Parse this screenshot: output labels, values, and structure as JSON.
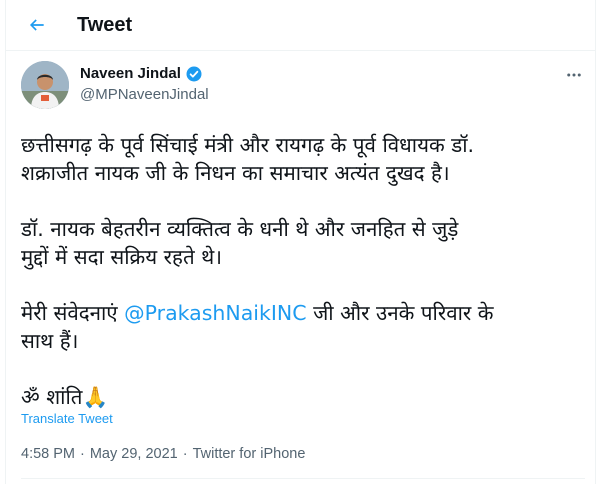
{
  "header": {
    "title": "Tweet",
    "back_icon": "arrow-left-icon"
  },
  "author": {
    "name": "Naveen Jindal",
    "handle": "@MPNaveenJindal",
    "verified": true,
    "verified_color": "#1d9bf0"
  },
  "tweet": {
    "para1_line1": "छत्तीसगढ़ के पूर्व सिंचाई मंत्री और रायगढ़ के पूर्व विधायक डॉ.",
    "para1_line2": "शक्राजीत नायक जी के निधन का समाचार अत्यंत दुखद है।",
    "para2_line1": "डॉ. नायक बेहतरीन व्यक्तित्व के धनी थे और जनहित से जुड़े",
    "para2_line2": "मुद्दों में सदा सक्रिय रहते थे।",
    "para3_prefix": "मेरी संवेदनाएं ",
    "para3_mention": "@PrakashNaikINC",
    "para3_suffix": " जी और उनके परिवार के",
    "para3_line2": "साथ हैं।",
    "para4_text": "ॐ शांति",
    "para4_emoji": "🙏"
  },
  "translate_label": "Translate Tweet",
  "meta": {
    "time": "4:58 PM",
    "sep1": "·",
    "date": "May 29, 2021",
    "sep2": "·",
    "source": "Twitter for iPhone"
  },
  "colors": {
    "accent": "#1d9bf0",
    "muted": "#536471",
    "text": "#0f1419",
    "border": "#eff3f4"
  }
}
